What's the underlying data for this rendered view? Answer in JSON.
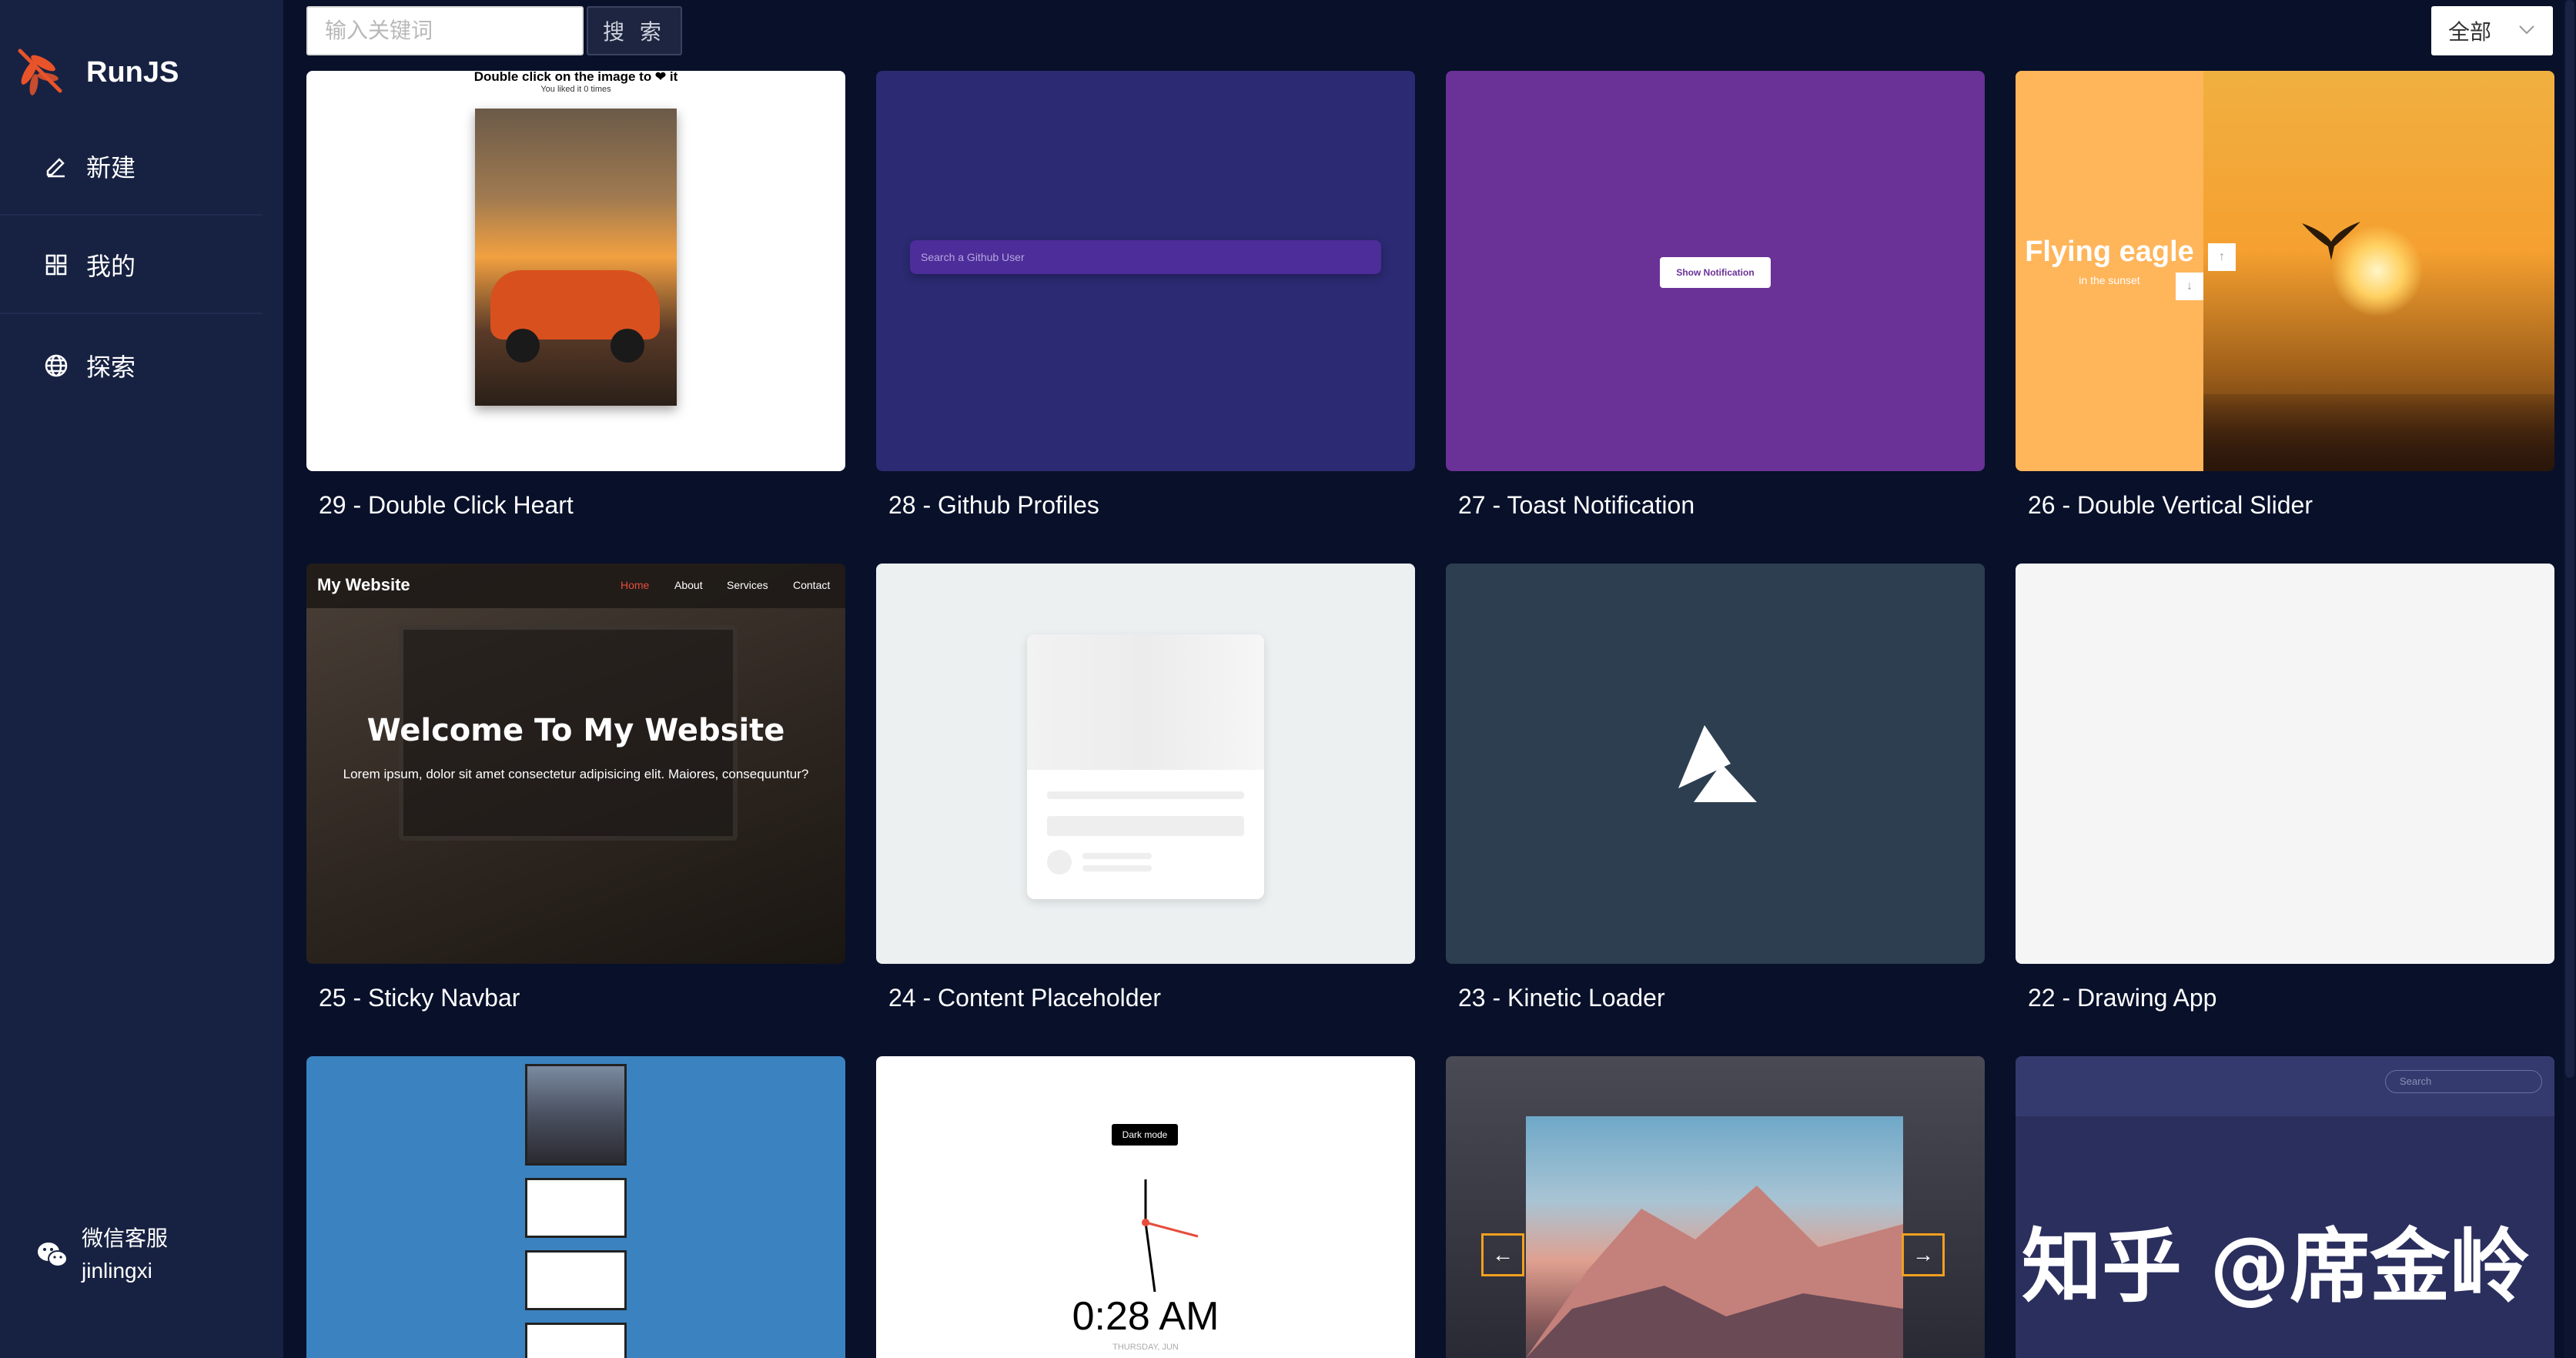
{
  "app": {
    "title": "RunJS"
  },
  "sidebar": {
    "items": [
      {
        "label": "新建",
        "icon": "edit-icon"
      },
      {
        "label": "我的",
        "icon": "grid-icon"
      },
      {
        "label": "探索",
        "icon": "globe-icon"
      }
    ],
    "service": {
      "title": "微信客服",
      "account": "jinlingxi"
    }
  },
  "search": {
    "placeholder": "输入关键词",
    "button_label": "搜 索"
  },
  "filter": {
    "selected": "全部"
  },
  "cards": [
    {
      "title": "29 - Double Click Heart",
      "preview": {
        "heading": "Double click on the image to ❤ it",
        "sub": "You liked it 0 times"
      }
    },
    {
      "title": "28 - Github Profiles",
      "preview": {
        "placeholder": "Search a Github User"
      }
    },
    {
      "title": "27 - Toast Notification",
      "preview": {
        "button": "Show Notification"
      }
    },
    {
      "title": "26 - Double Vertical Slider",
      "preview": {
        "heading": "Flying eagle",
        "sub": "in the sunset",
        "up": "↑",
        "down": "↓"
      }
    },
    {
      "title": "25 - Sticky Navbar",
      "preview": {
        "brand": "My Website",
        "nav": [
          "Home",
          "About",
          "Services",
          "Contact"
        ],
        "hero": "Welcome To My Website",
        "text": "Lorem ipsum, dolor sit amet consectetur adipisicing elit. Maiores, consequuntur?"
      }
    },
    {
      "title": "24 - Content Placeholder"
    },
    {
      "title": "23 - Kinetic Loader"
    },
    {
      "title": "22 - Drawing App"
    },
    {
      "title": "",
      "preview": {}
    },
    {
      "title": "",
      "preview": {
        "toggle": "Dark mode",
        "time": "0:28 AM",
        "date": "THURSDAY, JUN"
      }
    },
    {
      "title": "",
      "preview": {
        "left": "←",
        "right": "→"
      }
    },
    {
      "title": "",
      "preview": {
        "search": "Search"
      }
    }
  ],
  "watermark": "知乎 @席金岭",
  "colors": {
    "background": "#08102a",
    "sidebar": "#172242",
    "logo_accent": "#e8532a"
  }
}
